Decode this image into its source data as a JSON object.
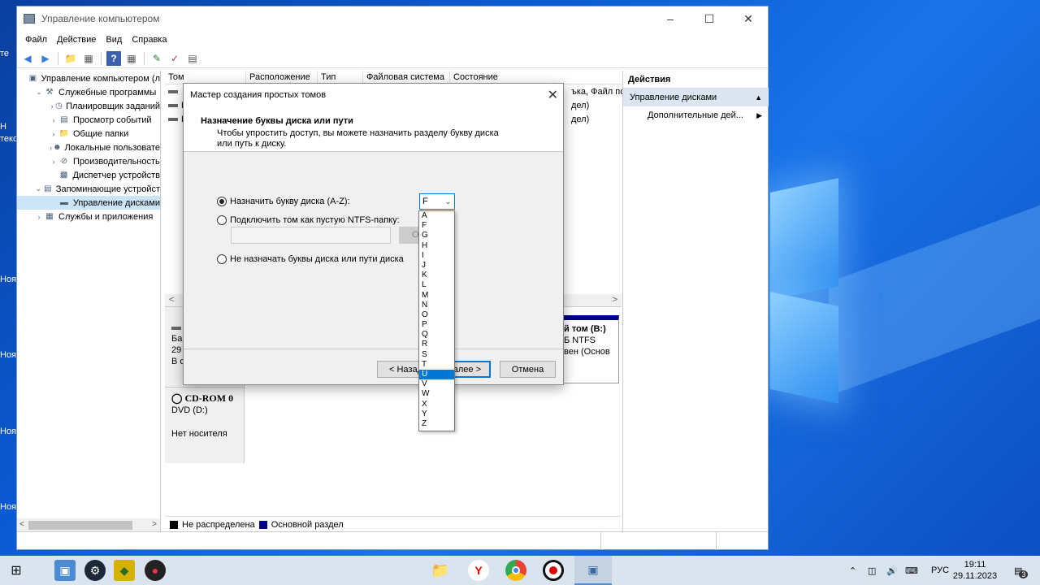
{
  "desktop": {
    "labels": [
      "те",
      "Н",
      "текс",
      "Ноя",
      "Ноя",
      "Ноя",
      "Ноя"
    ]
  },
  "window": {
    "title": "Управление компьютером",
    "menu": [
      "Файл",
      "Действие",
      "Вид",
      "Справка"
    ]
  },
  "tree": {
    "items": [
      {
        "label": "Управление компьютером (л",
        "icon": "computer-icon",
        "indent": 0,
        "twisty": ""
      },
      {
        "label": "Служебные программы",
        "icon": "tools-icon",
        "indent": 1,
        "twisty": "v"
      },
      {
        "label": "Планировщик заданий",
        "icon": "clock-icon",
        "indent": 2,
        "twisty": ">"
      },
      {
        "label": "Просмотр событий",
        "icon": "event-viewer-icon",
        "indent": 2,
        "twisty": ">"
      },
      {
        "label": "Общие папки",
        "icon": "shared-folder-icon",
        "indent": 2,
        "twisty": ">"
      },
      {
        "label": "Локальные пользовате",
        "icon": "users-icon",
        "indent": 2,
        "twisty": ">"
      },
      {
        "label": "Производительность",
        "icon": "performance-icon",
        "indent": 2,
        "twisty": ">"
      },
      {
        "label": "Диспетчер устройств",
        "icon": "device-manager-icon",
        "indent": 2,
        "twisty": ""
      },
      {
        "label": "Запоминающие устройст",
        "icon": "storage-icon",
        "indent": 1,
        "twisty": "v"
      },
      {
        "label": "Управление дисками",
        "icon": "disk-management-icon",
        "indent": 2,
        "twisty": ""
      },
      {
        "label": "Службы и приложения",
        "icon": "services-icon",
        "indent": 1,
        "twisty": ">"
      }
    ]
  },
  "volumes": {
    "columns": [
      "Том",
      "Расположение",
      "Тип",
      "Файловая система",
      "Состояние"
    ],
    "rows": [
      {
        "name": "",
        "status": "ъка, Файл по"
      },
      {
        "name": "Н",
        "status": "дел)"
      },
      {
        "name": "Н",
        "status": "дел)"
      }
    ]
  },
  "disks": {
    "disk0": {
      "line1": "Ба",
      "line2": "29",
      "line3": "В с"
    },
    "volume": {
      "name": "й том  (B:)",
      "fs": "Б NTFS",
      "status": "вен (Основ"
    },
    "cdrom": {
      "title": "CD-ROM 0",
      "type": "DVD (D:)",
      "media": "Нет носителя"
    }
  },
  "legend": {
    "unallocated": "Не распределена",
    "primary": "Основной раздел"
  },
  "actions": {
    "header": "Действия",
    "section": "Управление дисками",
    "more": "Дополнительные дей..."
  },
  "dialog": {
    "title": "Мастер создания простых томов",
    "heading": "Назначение буквы диска или пути",
    "description": "Чтобы упростить доступ, вы можете назначить разделу букву диска или путь к диску.",
    "option_assign": "Назначить букву диска (A-Z):",
    "option_mount": "Подключить том как пустую NTFS-папку:",
    "option_none": "Не назначать буквы диска или пути диска",
    "browse_partial": "О",
    "selected_letter": "F",
    "back": "< Назад",
    "next": "Далее >",
    "cancel": "Отмена"
  },
  "dropdown": {
    "options": [
      "A",
      "F",
      "G",
      "H",
      "I",
      "J",
      "K",
      "L",
      "M",
      "N",
      "O",
      "P",
      "Q",
      "R",
      "S",
      "T",
      "U",
      "V",
      "W",
      "X",
      "Y",
      "Z"
    ],
    "highlighted": "U"
  },
  "taskbar": {
    "lang": "РУС",
    "time": "19:11",
    "date": "29.11.2023",
    "notifications": "3"
  },
  "colors": {
    "accent": "#0078d7",
    "legend_unallocated": "#000000",
    "legend_primary": "#00008b"
  }
}
